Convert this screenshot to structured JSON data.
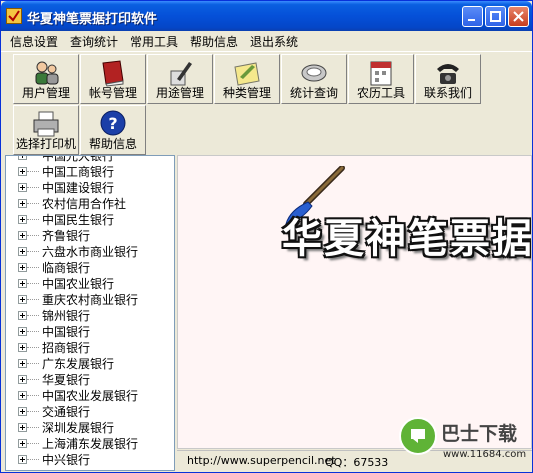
{
  "window": {
    "title": "华夏神笔票据打印软件"
  },
  "menu": [
    "信息设置",
    "查询统计",
    "常用工具",
    "帮助信息",
    "退出系统"
  ],
  "toolbar": {
    "row1": [
      {
        "label": "用户管理",
        "icon": "users-icon"
      },
      {
        "label": "帐号管理",
        "icon": "book-icon"
      },
      {
        "label": "用途管理",
        "icon": "pen-icon"
      },
      {
        "label": "种类管理",
        "icon": "notepad-icon"
      },
      {
        "label": "统计查询",
        "icon": "magnifier-icon"
      },
      {
        "label": "农历工具",
        "icon": "calendar-icon"
      },
      {
        "label": "联系我们",
        "icon": "telephone-icon"
      }
    ],
    "row2": [
      {
        "label": "选择打印机",
        "icon": "printer-icon"
      },
      {
        "label": "帮助信息",
        "icon": "help-icon"
      }
    ]
  },
  "tree": [
    "中国光大银行",
    "中国工商银行",
    "中国建设银行",
    "农村信用合作社",
    "中国民生银行",
    "齐鲁银行",
    "六盘水市商业银行",
    "临商银行",
    "中国农业银行",
    "重庆农村商业银行",
    "锦州银行",
    "中国银行",
    "招商银行",
    "广东发展银行",
    "华夏银行",
    "中国农业发展银行",
    "交通银行",
    "深圳发展银行",
    "上海浦东发展银行",
    "中兴银行"
  ],
  "banner": {
    "text": "华夏神笔票据"
  },
  "status": {
    "url": "http://www.superpencil.net",
    "qq": "QQ：67533"
  },
  "watermark": {
    "name": "巴士下载",
    "url": "www.11684.com"
  },
  "colors": {
    "titlebar": "#0550D8",
    "chrome": "#ECE9D8",
    "main_bg": "#FFF5F5"
  }
}
